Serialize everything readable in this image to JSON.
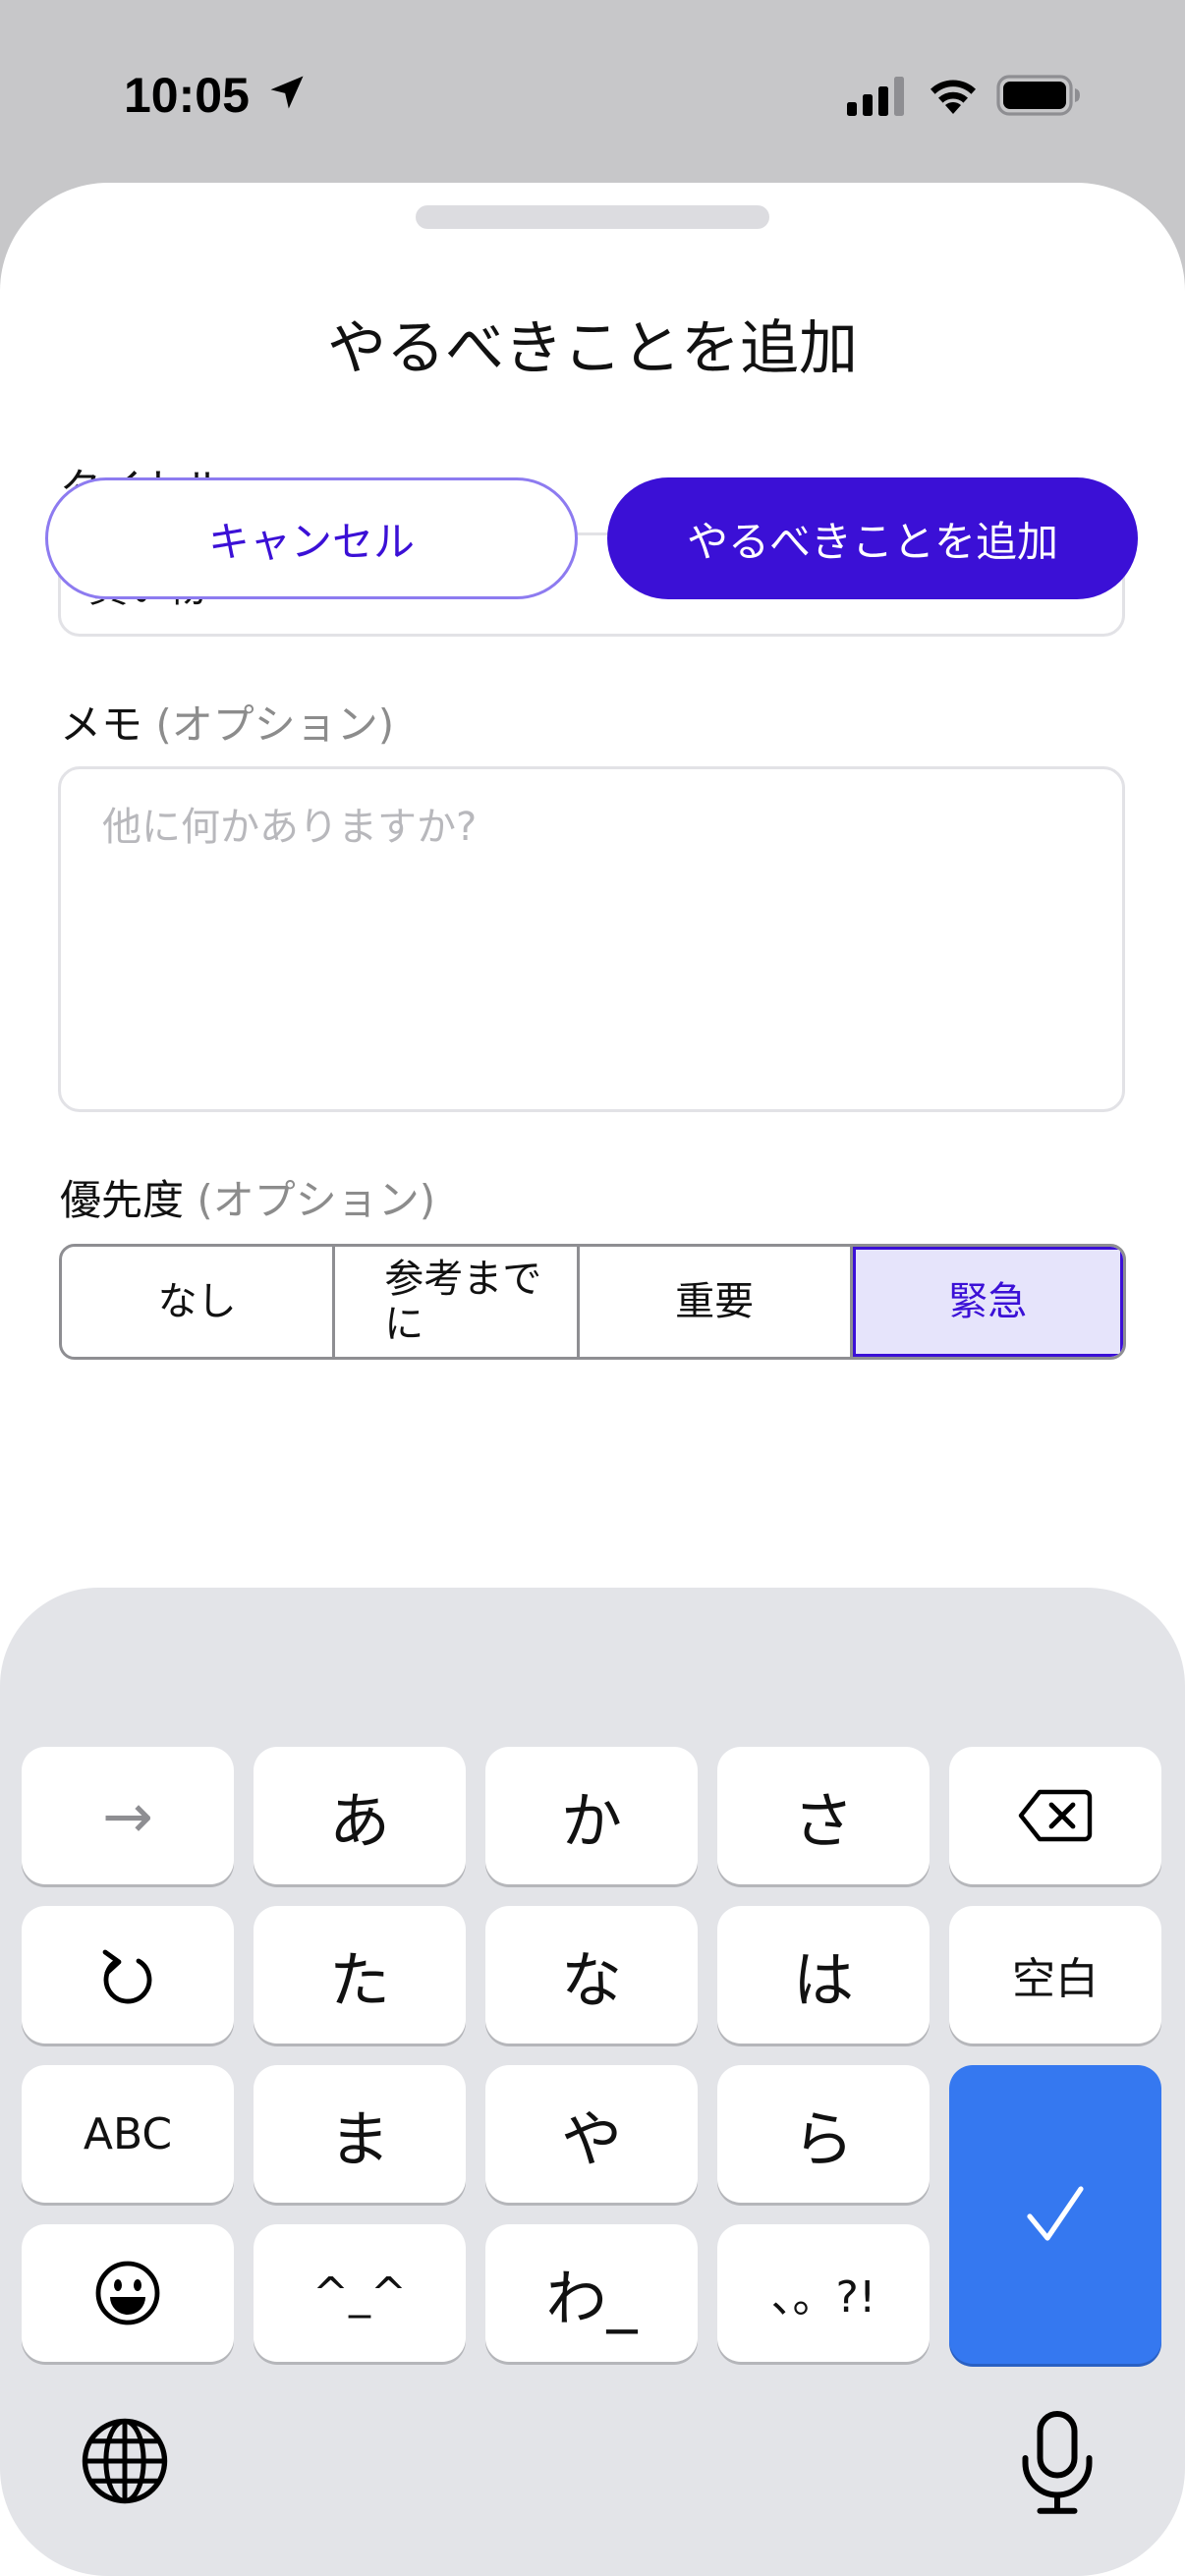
{
  "status_bar": {
    "time": "10:05",
    "icons": [
      "location-arrow-icon",
      "cellular-signal-icon",
      "wifi-icon",
      "battery-icon"
    ]
  },
  "sheet": {
    "title": "やるべきことを追加",
    "title_field": {
      "label": "タイトル",
      "value": "買い物"
    },
    "memo_field": {
      "label": "メモ",
      "optional": "(オプション)",
      "placeholder": "他に何かありますか?",
      "value": ""
    },
    "priority": {
      "label": "優先度",
      "optional": "(オプション)",
      "options": [
        "なし",
        "参考までに",
        "重要",
        "緊急"
      ],
      "selected": "緊急"
    },
    "actions": {
      "cancel_label": "キャンセル",
      "add_label": "やるべきことを追加"
    },
    "colors": {
      "accent": "#3b10d6",
      "selected_segment_bg": "#e6e4fb"
    }
  },
  "keyboard": {
    "type": "japanese-kana-flick",
    "rows": [
      [
        "→",
        "あ",
        "か",
        "さ",
        "delete-icon"
      ],
      [
        "undo-icon",
        "た",
        "な",
        "は",
        "空白"
      ],
      [
        "ABC",
        "ま",
        "や",
        "ら"
      ],
      [
        "emoji-icon",
        "^_^",
        "わ_",
        "、。?!"
      ]
    ],
    "keys": {
      "arrow": "→",
      "a": "あ",
      "ka": "か",
      "sa": "さ",
      "ta": "た",
      "na": "な",
      "ha": "は",
      "space": "空白",
      "abc": "ABC",
      "ma": "ま",
      "ya": "や",
      "ra": "ら",
      "kaomoji": "^_^",
      "wa": "わ_",
      "punct": "、。?!"
    },
    "enter_key": "checkmark-icon",
    "bottom_icons": [
      "globe-icon",
      "microphone-icon"
    ],
    "colors": {
      "enter": "#3578f0",
      "background": "#e3e4e8"
    }
  }
}
